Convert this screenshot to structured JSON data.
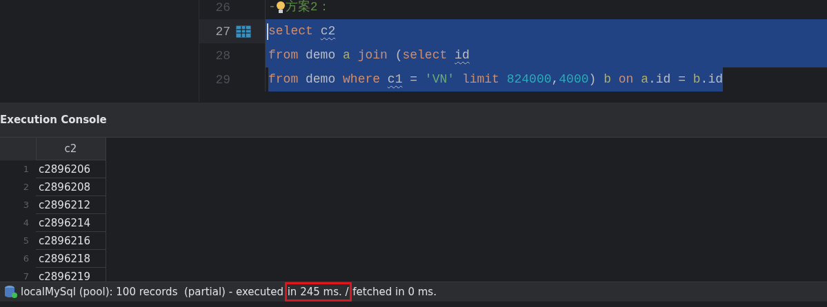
{
  "editor": {
    "lines": [
      {
        "number": "26",
        "selected": false,
        "current": false,
        "table_icon": false,
        "tokens": [
          {
            "kind": "comment",
            "text": "-"
          },
          {
            "kind": "bulb"
          },
          {
            "kind": "comment",
            "text": "方案2："
          }
        ]
      },
      {
        "number": "27",
        "selected": true,
        "current": true,
        "table_icon": true,
        "tokens": [
          {
            "kind": "keyword",
            "text": "select "
          },
          {
            "kind": "ident",
            "text": "c2",
            "wavy": true
          }
        ]
      },
      {
        "number": "28",
        "selected": true,
        "current": false,
        "table_icon": false,
        "tokens": [
          {
            "kind": "keyword",
            "text": "from "
          },
          {
            "kind": "plain",
            "text": "demo "
          },
          {
            "kind": "alias",
            "text": "a "
          },
          {
            "kind": "keyword",
            "text": "join "
          },
          {
            "kind": "plain",
            "text": "("
          },
          {
            "kind": "keyword",
            "text": "select "
          },
          {
            "kind": "ident",
            "text": "id",
            "wavy": true
          }
        ]
      },
      {
        "number": "29",
        "selected": true,
        "current": false,
        "table_icon": false,
        "tokens": [
          {
            "kind": "keyword",
            "text": "from "
          },
          {
            "kind": "plain",
            "text": "demo "
          },
          {
            "kind": "keyword",
            "text": "where "
          },
          {
            "kind": "ident",
            "text": "c1",
            "wavy": true
          },
          {
            "kind": "plain",
            "text": " = "
          },
          {
            "kind": "string",
            "text": "'VN' "
          },
          {
            "kind": "keyword",
            "text": "limit "
          },
          {
            "kind": "number",
            "text": "824000"
          },
          {
            "kind": "plain",
            "text": ","
          },
          {
            "kind": "number",
            "text": "4000"
          },
          {
            "kind": "plain",
            "text": ") "
          },
          {
            "kind": "alias",
            "text": "b "
          },
          {
            "kind": "keyword",
            "text": "on "
          },
          {
            "kind": "alias",
            "text": "a"
          },
          {
            "kind": "plain",
            "text": ".id = "
          },
          {
            "kind": "alias",
            "text": "b"
          },
          {
            "kind": "plain",
            "text": ".id"
          }
        ]
      }
    ]
  },
  "console": {
    "title": "Execution Console",
    "table": {
      "columns": [
        "c2"
      ],
      "rows": [
        {
          "number": "1",
          "c2": "c2896206"
        },
        {
          "number": "2",
          "c2": "c2896208"
        },
        {
          "number": "3",
          "c2": "c2896212"
        },
        {
          "number": "4",
          "c2": "c2896214"
        },
        {
          "number": "5",
          "c2": "c2896216"
        },
        {
          "number": "6",
          "c2": "c2896218"
        },
        {
          "number": "7",
          "c2": "c2896219"
        }
      ]
    }
  },
  "status_bar": {
    "segments": [
      {
        "text": "localMySql (pool): 100 records  (partial) - executed ",
        "highlighted": false
      },
      {
        "text": "in 245 ms. /",
        "highlighted": true
      },
      {
        "text": " fetched in 0 ms.",
        "highlighted": false
      }
    ]
  }
}
